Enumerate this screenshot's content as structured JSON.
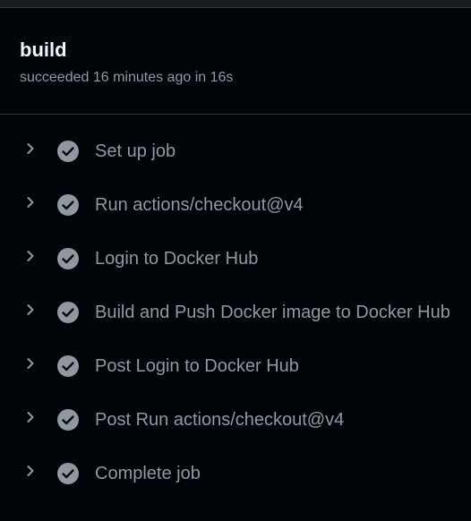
{
  "job": {
    "title": "build",
    "status": "succeeded 16 minutes ago in 16s"
  },
  "steps": [
    {
      "label": "Set up job",
      "status": "success",
      "icon": "check-circle-icon"
    },
    {
      "label": "Run actions/checkout@v4",
      "status": "success",
      "icon": "check-circle-icon"
    },
    {
      "label": "Login to Docker Hub",
      "status": "success",
      "icon": "check-circle-icon"
    },
    {
      "label": "Build and Push Docker image to Docker Hub",
      "status": "success",
      "icon": "check-circle-icon"
    },
    {
      "label": "Post Login to Docker Hub",
      "status": "success",
      "icon": "check-circle-icon"
    },
    {
      "label": "Post Run actions/checkout@v4",
      "status": "success",
      "icon": "check-circle-icon"
    },
    {
      "label": "Complete job",
      "status": "success",
      "icon": "check-circle-icon"
    }
  ],
  "colors": {
    "background": "#010409",
    "border": "#30363d",
    "title": "#f0f6fc",
    "muted": "#9198a1",
    "check_fill": "#9198a1"
  }
}
